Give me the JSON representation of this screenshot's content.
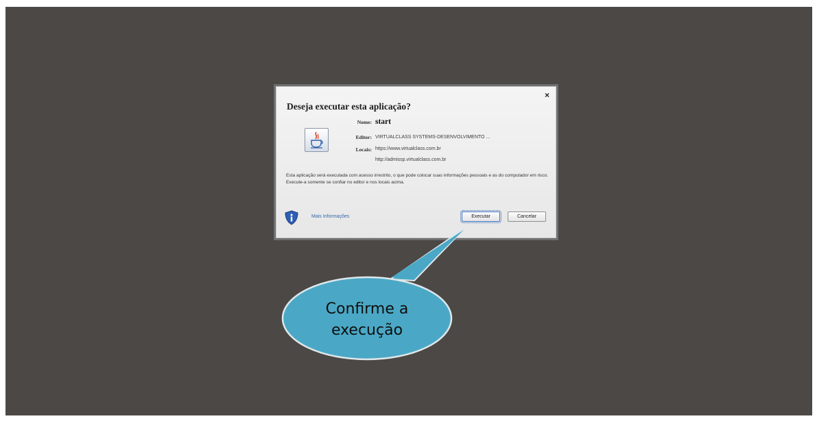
{
  "dialog": {
    "title": "Deseja executar esta aplicação?",
    "close_label": "×",
    "name_label": "Nome:",
    "name_value": "start",
    "publisher_label": "Editor:",
    "publisher_value": "VIRTUALCLASS SYSTEMS-DESENVOLVIMENTO ...",
    "locations_label": "Locais:",
    "location_1": "https://www.virtualclass.com.br",
    "location_2": "http://admissp.virtualclass.com.br",
    "warning_text": "Esta aplicação será executada com acesso irrestrito, o que pode colocar suas informações pessoais e as do computador em risco. Execute-a somente se confiar no editor e nos locais acima.",
    "more_info_label": "Mais Informações",
    "run_button": "Executar",
    "cancel_button": "Cancelar",
    "app_icon": "java-icon",
    "info_icon": "shield-info-icon"
  },
  "callout": {
    "line1": "Confirme a",
    "line2": "execução",
    "fill_color": "#4aa8c6",
    "border_color": "#dfe7ea"
  },
  "colors": {
    "backdrop": "#4b4846",
    "dialog_bg": "#efefef"
  }
}
